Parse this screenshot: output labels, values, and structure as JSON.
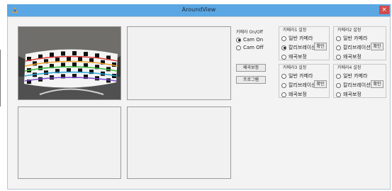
{
  "window": {
    "title": "AroundView",
    "close_glyph": "×"
  },
  "cam_control": {
    "title": "카메라 On/Off",
    "options": [
      {
        "label": "Cam On",
        "selected": true
      },
      {
        "label": "Cam Off",
        "selected": false
      }
    ]
  },
  "buttons": {
    "distortion": "왜곡보정",
    "program": "프로그램"
  },
  "cameras": [
    {
      "title": "카메라1 설정",
      "options": [
        "일반 카메라",
        "칼리브레이션",
        "왜곡보정"
      ],
      "selected": 1,
      "confirm": "확인"
    },
    {
      "title": "카메라2 설정",
      "options": [
        "일반 카메라",
        "칼리브레이션",
        "왜곡보정"
      ],
      "selected": -1,
      "confirm": "확인"
    },
    {
      "title": "카메라3 설정",
      "options": [
        "일반 카메라",
        "칼리브레이션",
        "왜곡보정"
      ],
      "selected": -1,
      "confirm": "확인"
    },
    {
      "title": "카메라4 설정",
      "options": [
        "일반 카메라",
        "칼리브레이션",
        "왜곡보정"
      ],
      "selected": -1,
      "confirm": "확인"
    }
  ],
  "colors": {
    "titlebar": "#5aa7e3",
    "close": "#d04b4b"
  }
}
